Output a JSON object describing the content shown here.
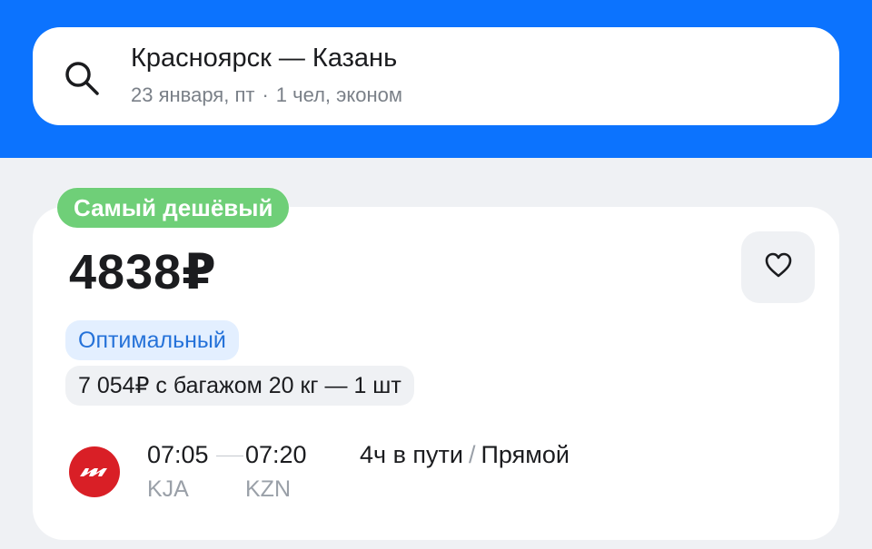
{
  "search": {
    "route": "Красноярск — Казань",
    "date": "23 января, пт",
    "separator": "·",
    "passengers": "1 чел, эконом"
  },
  "offer": {
    "badge": "Самый дешёвый",
    "price": "4838₽",
    "tariff": "Оптимальный",
    "baggage_option": "7 054₽ с багажом 20 кг — 1 шт",
    "departure_time": "07:05",
    "arrival_time": "07:20",
    "departure_airport": "KJA",
    "arrival_airport": "KZN",
    "duration": "4ч в пути",
    "duration_separator": "/",
    "stops": "Прямой"
  },
  "icons": {
    "search": "search-icon",
    "favorite": "heart-icon",
    "airline": "airline-logo"
  },
  "colors": {
    "header_bg": "#0c73fe",
    "badge_green": "#6fcf78",
    "tariff_blue": "#2572d9",
    "airline_red": "#d91f26"
  }
}
